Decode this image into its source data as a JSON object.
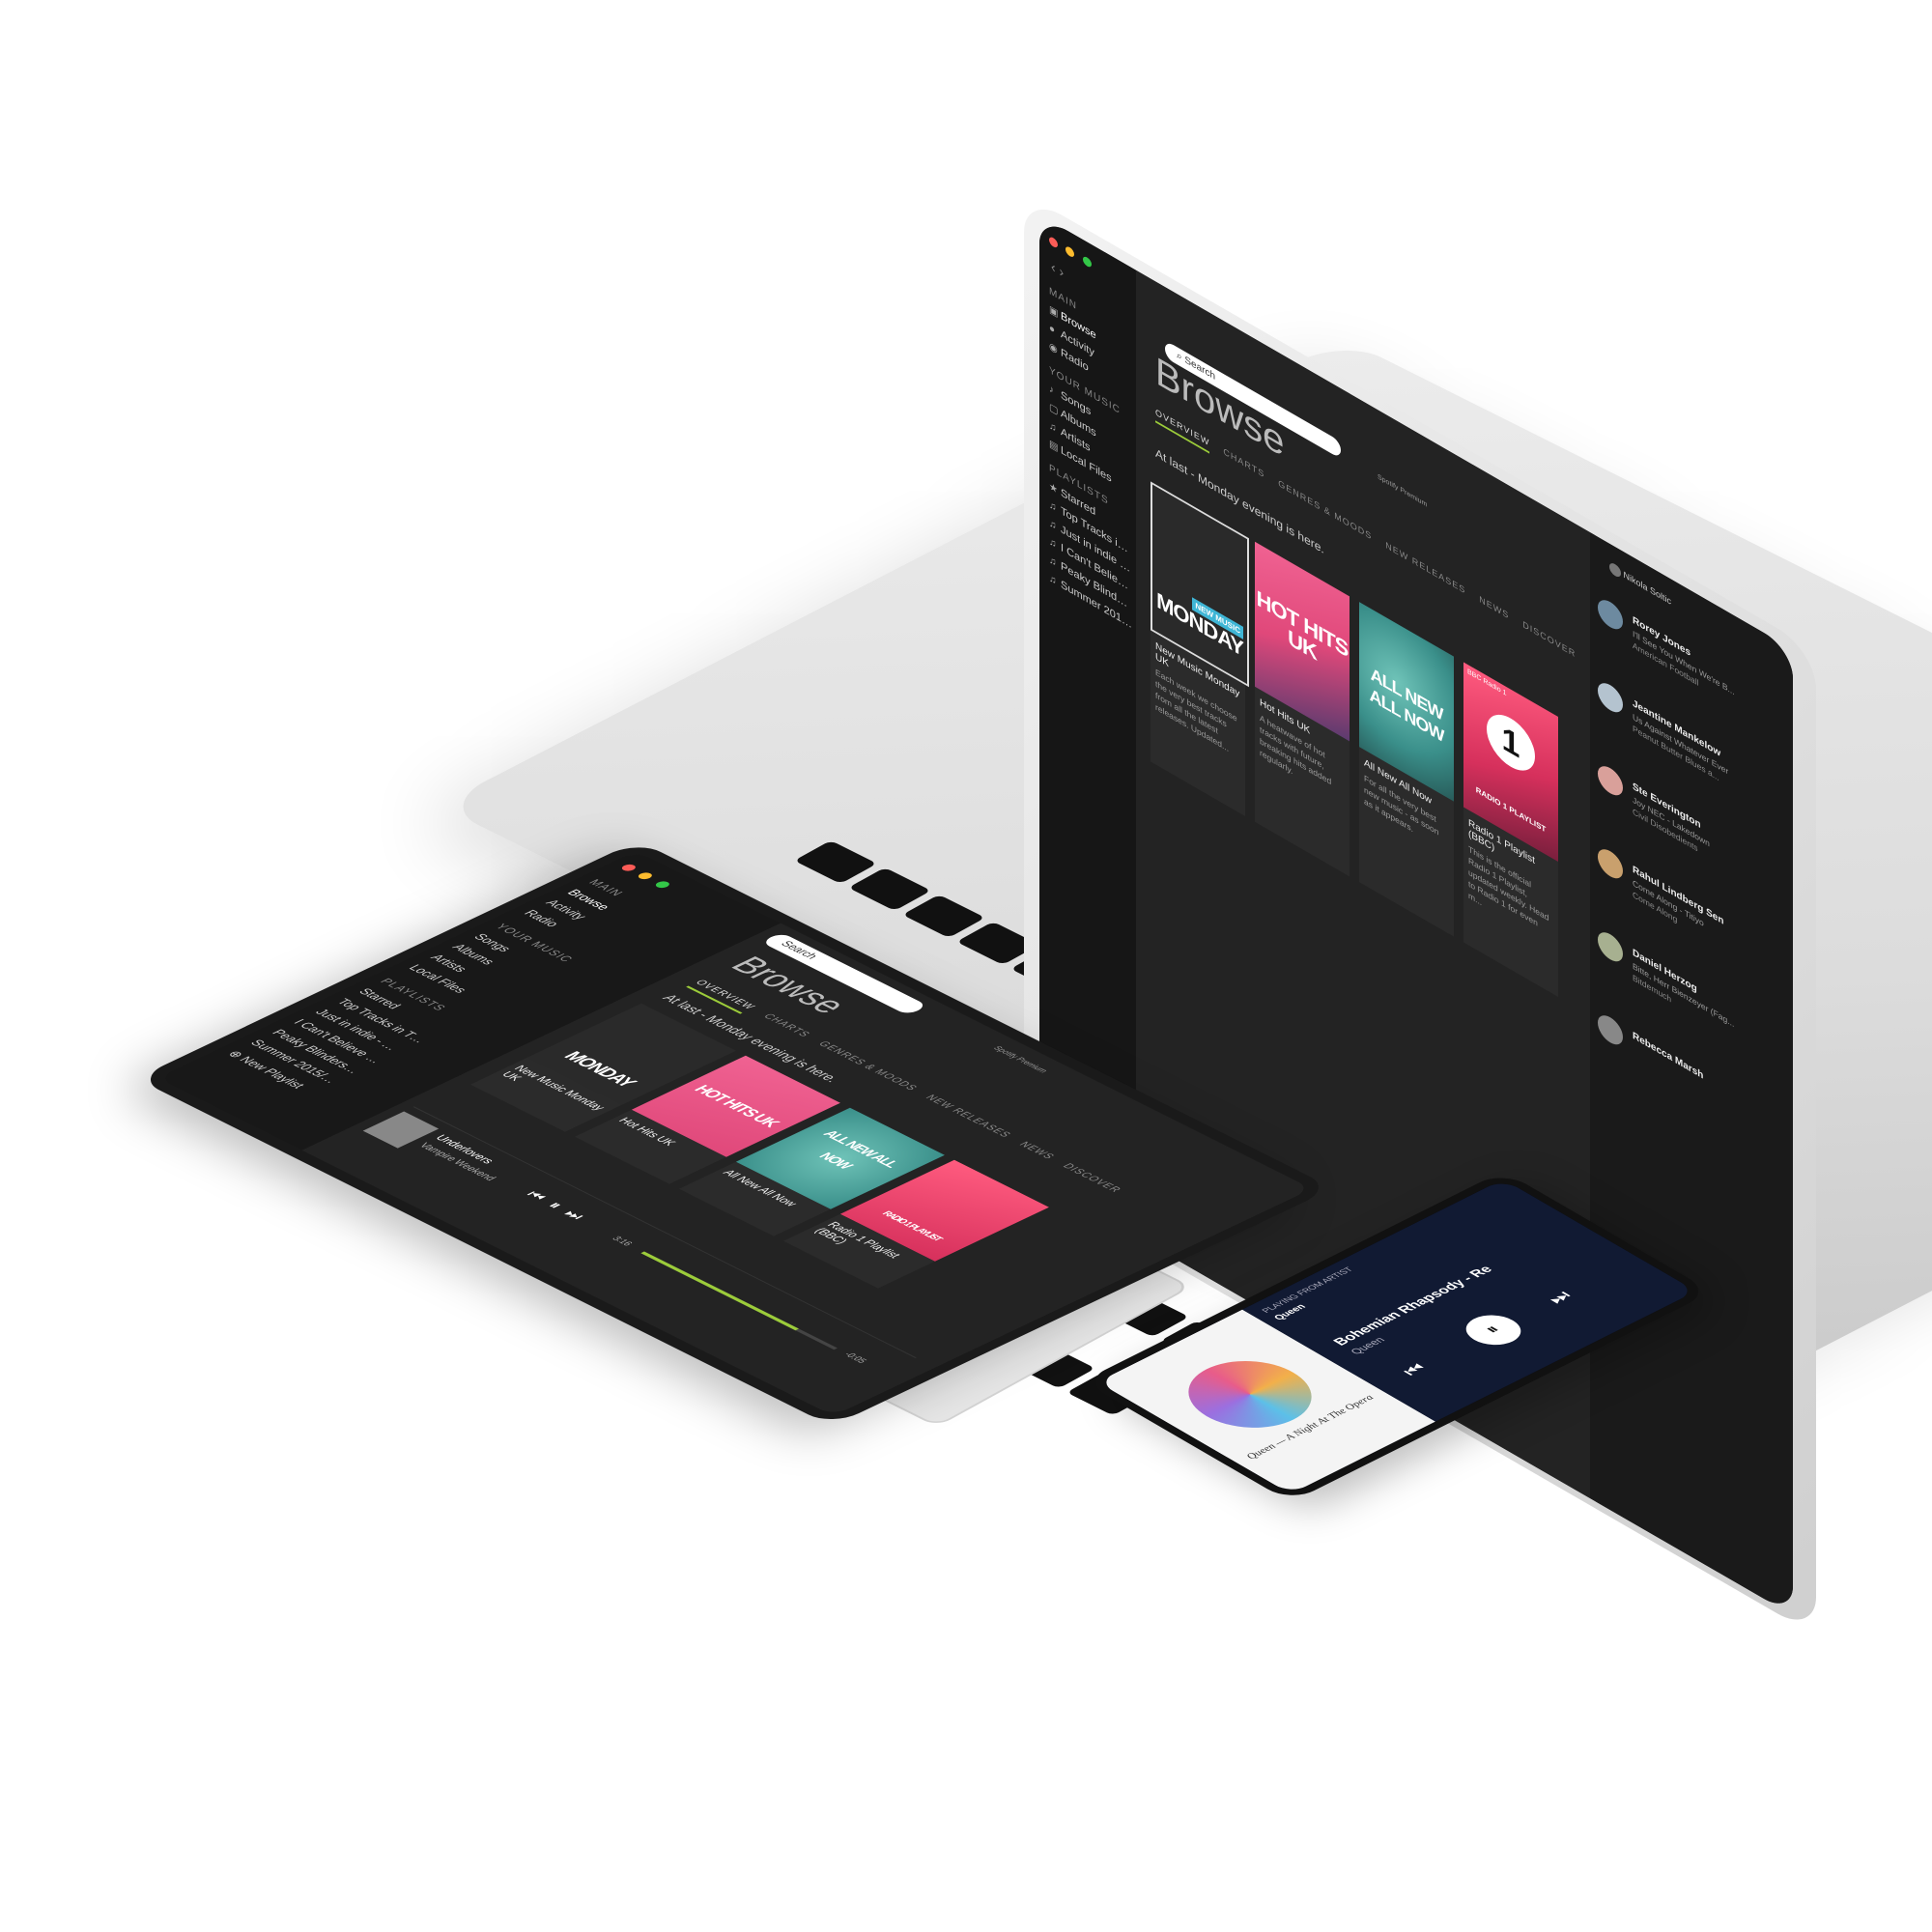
{
  "laptop": {
    "window_title": "Spotify Premium",
    "search": {
      "placeholder": "Search"
    },
    "user": {
      "name": "Nikola Soltic"
    },
    "sidebar": {
      "main_heading": "MAIN",
      "main_items": [
        "Browse",
        "Activity",
        "Radio"
      ],
      "your_music_heading": "YOUR MUSIC",
      "your_music_items": [
        "Songs",
        "Albums",
        "Artists",
        "Local Files"
      ],
      "playlists_heading": "PLAYLISTS",
      "playlists": [
        "Starred",
        "Top Tracks in The U...",
        "Just in indie - Nov 14 ...",
        "I Can't Believe It's No...",
        "Peaky Blinders Soun...",
        "Summer 2015/5 Coo..."
      ]
    },
    "browse": {
      "title": "Browse",
      "tabs": [
        "OVERVIEW",
        "CHARTS",
        "GENRES & MOODS",
        "NEW RELEASES",
        "NEWS",
        "DISCOVER"
      ],
      "greeting": "At last - Monday evening is here.",
      "cards": [
        {
          "cover_text": "MONDAY",
          "badge": "NEW MUSIC",
          "title": "New Music Monday UK",
          "desc": "Each week we choose the very best tracks from all the latest releases. Updated...",
          "color": "#2a2a2a"
        },
        {
          "cover_text": "HOT HITS UK",
          "title": "Hot Hits UK",
          "desc": "A heatwave of hot tracks with future, breaking hits added regularly.",
          "color": "#e0487a"
        },
        {
          "cover_text": "ALL NEW ALL NOW",
          "title": "All New All Now",
          "desc": "For all the very best new music - as soon as it appears.",
          "color": "#3a8f8a"
        },
        {
          "cover_text": "RADIO 1 PLAYLIST",
          "badge": "BBC Radio 1",
          "title": "Radio 1 Playlist (BBC)",
          "desc": "This is the official Radio 1 Playlist, updated weekly. Head to Radio 1 for even m...",
          "color": "#d6305c"
        }
      ]
    },
    "friends": [
      {
        "name": "Rorey Jones",
        "track": "I'll See You When We're B...",
        "playlist": "American Football"
      },
      {
        "name": "Jeantine Mankelow",
        "track": "Us Against Whatever Ever",
        "playlist": "Peanut Butter Blues a..."
      },
      {
        "name": "Ste Everington",
        "track": "Joy NEC - Lakedown",
        "playlist": "Civil Disobedients"
      },
      {
        "name": "Rahul Lindberg Sen",
        "track": "Come Along - Titiyo",
        "playlist": "Come Along"
      },
      {
        "name": "Daniel Herzog",
        "track": "Bitte, Herr Bienzeyer (Fag...",
        "playlist": "Bitdemuch"
      },
      {
        "name": "Rebecca Marsh",
        "track": "",
        "playlist": ""
      }
    ]
  },
  "tablet": {
    "window_title": "Spotify Premium",
    "search": {
      "placeholder": "Search"
    },
    "sidebar": {
      "main_heading": "MAIN",
      "main_items": [
        "Browse",
        "Activity",
        "Radio"
      ],
      "your_music_heading": "YOUR MUSIC",
      "your_music_items": [
        "Songs",
        "Albums",
        "Artists",
        "Local Files"
      ],
      "playlists_heading": "PLAYLISTS",
      "playlists": [
        "Starred",
        "Top Tracks in The U...",
        "Just in indie - Nov 14 ...",
        "I Can't Believe It's No...",
        "Peaky Blinders Soun...",
        "Summer 2015/5 Cool..."
      ],
      "new_playlist": "New Playlist"
    },
    "browse": {
      "title": "Browse",
      "tabs": [
        "OVERVIEW",
        "CHARTS",
        "GENRES & MOODS",
        "NEW RELEASES",
        "NEWS",
        "DISCOVER"
      ],
      "greeting": "At last - Monday evening is here.",
      "cards": [
        {
          "title": "New Music Monday UK",
          "cover_text": "MONDAY",
          "color": "#2a2a2a"
        },
        {
          "title": "Hot Hits UK",
          "cover_text": "HOT HITS UK",
          "color": "#e0487a"
        },
        {
          "title": "All New All Now",
          "cover_text": "ALL NEW ALL NOW",
          "color": "#3a8f8a"
        },
        {
          "title": "Radio 1 Playlist (BBC)",
          "cover_text": "RADIO 1 PLAYLIST",
          "color": "#d6305c"
        }
      ]
    },
    "player": {
      "track": "Underlovers",
      "artist": "Vampire Weekend",
      "elapsed": "3:16",
      "remaining": "-0:05"
    }
  },
  "phone": {
    "header": "PLAYING FROM ARTIST",
    "context": "Queen",
    "album_art_text": "Queen — A Night At The Opera",
    "track": "Bohemian Rhapsody - Re",
    "artist": "Queen"
  },
  "colors": {
    "accent": "#9ccc3a",
    "laptop_body": "#dcdcdc",
    "screen_bg": "#1d1d1d",
    "phone_bg": "#111a33"
  }
}
